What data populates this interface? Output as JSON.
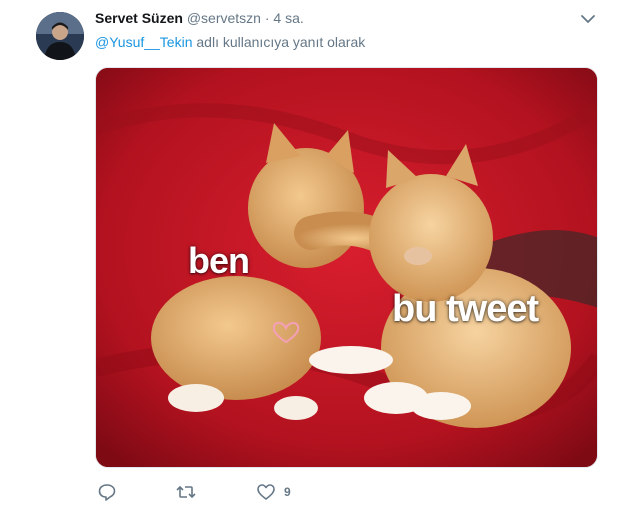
{
  "tweet": {
    "author_name": "Servet Süzen",
    "author_handle": "@servetszn",
    "separator": "·",
    "time": "4 sa.",
    "reply_mention": "@Yusuf__Tekin",
    "reply_suffix": " adlı kullanıcıya yanıt olarak",
    "media": {
      "caption_left": "ben",
      "caption_right": "bu tweet"
    },
    "actions": {
      "reply_icon": "reply-icon",
      "retweet_icon": "retweet-icon",
      "like_icon": "like-icon",
      "like_count": "9"
    }
  },
  "colors": {
    "link": "#1b95e0",
    "muted": "#657786",
    "text": "#14171a"
  }
}
